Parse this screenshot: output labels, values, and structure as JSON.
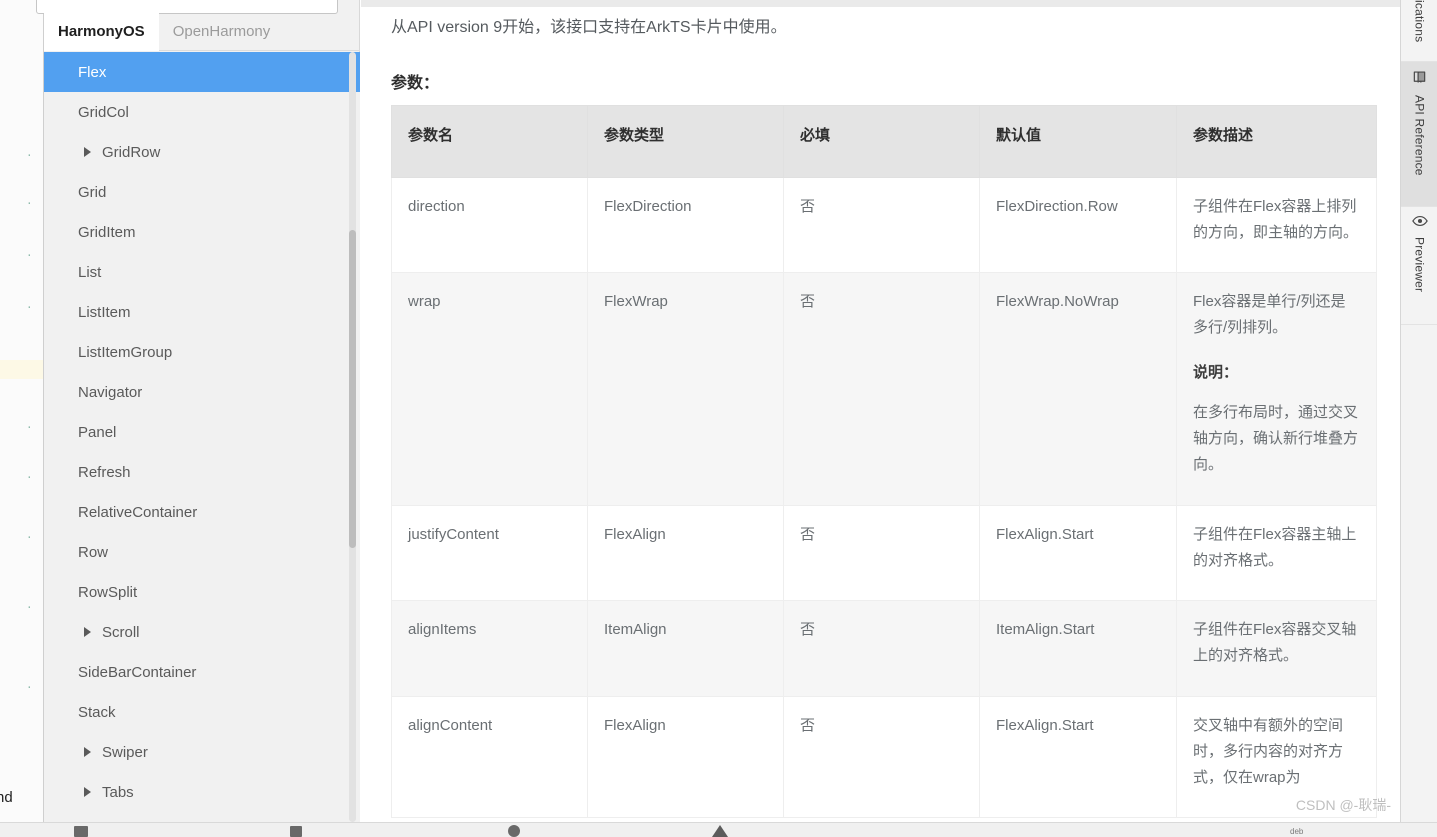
{
  "search": {
    "value": "",
    "placeholder": ""
  },
  "tabs": [
    {
      "label": "HarmonyOS",
      "active": true
    },
    {
      "label": "OpenHarmony",
      "active": false
    }
  ],
  "sidebar": {
    "items": [
      {
        "label": "Flex",
        "selected": true,
        "expandable": false
      },
      {
        "label": "GridCol",
        "selected": false,
        "expandable": false
      },
      {
        "label": "GridRow",
        "selected": false,
        "expandable": true
      },
      {
        "label": "Grid",
        "selected": false,
        "expandable": false
      },
      {
        "label": "GridItem",
        "selected": false,
        "expandable": false
      },
      {
        "label": "List",
        "selected": false,
        "expandable": false
      },
      {
        "label": "ListItem",
        "selected": false,
        "expandable": false
      },
      {
        "label": "ListItemGroup",
        "selected": false,
        "expandable": false
      },
      {
        "label": "Navigator",
        "selected": false,
        "expandable": false
      },
      {
        "label": "Panel",
        "selected": false,
        "expandable": false
      },
      {
        "label": "Refresh",
        "selected": false,
        "expandable": false
      },
      {
        "label": "RelativeContainer",
        "selected": false,
        "expandable": false
      },
      {
        "label": "Row",
        "selected": false,
        "expandable": false
      },
      {
        "label": "RowSplit",
        "selected": false,
        "expandable": false
      },
      {
        "label": "Scroll",
        "selected": false,
        "expandable": true
      },
      {
        "label": "SideBarContainer",
        "selected": false,
        "expandable": false
      },
      {
        "label": "Stack",
        "selected": false,
        "expandable": false
      },
      {
        "label": "Swiper",
        "selected": false,
        "expandable": true
      },
      {
        "label": "Tabs",
        "selected": false,
        "expandable": true
      }
    ]
  },
  "document": {
    "intro": "从API version 9开始，该接口支持在ArkTS卡片中使用。",
    "section_title": "参数：",
    "table": {
      "headers": [
        "参数名",
        "参数类型",
        "必填",
        "默认值",
        "参数描述"
      ],
      "rows": [
        {
          "name": "direction",
          "type": "FlexDirection",
          "required": "否",
          "default": "FlexDirection.Row",
          "description": "子组件在Flex容器上排列的方向，即主轴的方向。",
          "note_label": "",
          "note_text": ""
        },
        {
          "name": "wrap",
          "type": "FlexWrap",
          "required": "否",
          "default": "FlexWrap.NoWrap",
          "description": "Flex容器是单行/列还是多行/列排列。",
          "note_label": "说明：",
          "note_text": "在多行布局时，通过交叉轴方向，确认新行堆叠方向。"
        },
        {
          "name": "justifyContent",
          "type": "FlexAlign",
          "required": "否",
          "default": "FlexAlign.Start",
          "description": "子组件在Flex容器主轴上的对齐格式。",
          "note_label": "",
          "note_text": ""
        },
        {
          "name": "alignItems",
          "type": "ItemAlign",
          "required": "否",
          "default": "ItemAlign.Start",
          "description": "子组件在Flex容器交叉轴上的对齐格式。",
          "note_label": "",
          "note_text": ""
        },
        {
          "name": "alignContent",
          "type": "FlexAlign",
          "required": "否",
          "default": "FlexAlign.Start",
          "description": "交叉轴中有额外的空间时，多行内容的对齐方式，仅在wrap为",
          "note_label": "",
          "note_text": ""
        }
      ]
    }
  },
  "right_rail": {
    "items": [
      {
        "label": "ications",
        "icon": "",
        "active": false,
        "clipped": true
      },
      {
        "label": "API Reference",
        "icon": "book-icon",
        "active": true,
        "clipped": false
      },
      {
        "label": "Previewer",
        "icon": "eye-icon",
        "active": false,
        "clipped": false
      }
    ]
  },
  "watermark": "CSDN @-耿瑞-",
  "colors": {
    "selection_blue": "#52a0f0",
    "table_header_bg": "#e4e4e4",
    "alt_row_bg": "#f6f6f6",
    "panel_bg": "#f1f1f1",
    "text_muted": "#6a6f73"
  },
  "ide_peek": {
    "tail_word": "nd"
  }
}
